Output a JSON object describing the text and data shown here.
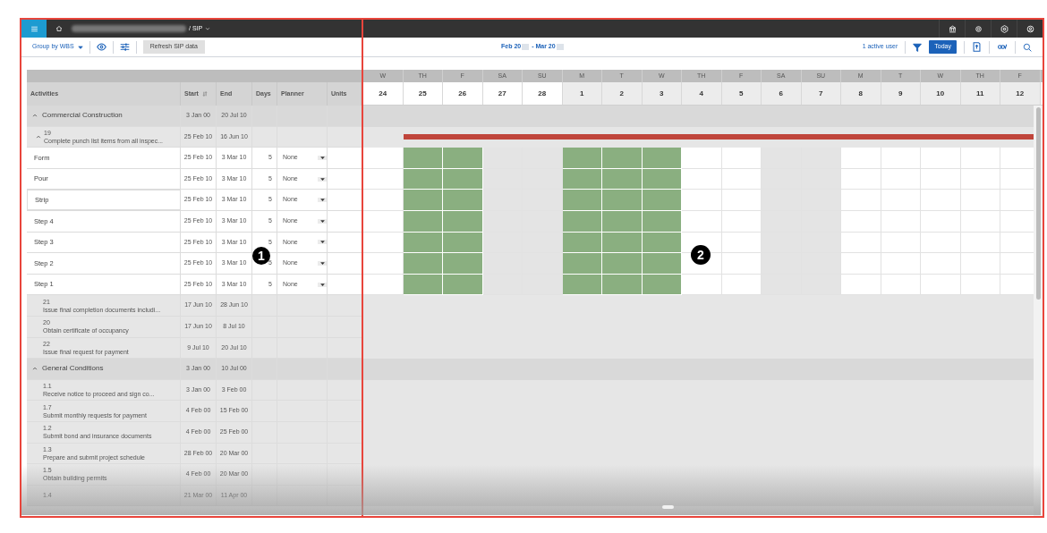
{
  "breadcrumb": {
    "title": "/ SIP"
  },
  "toolbar": {
    "group_by": "Group by WBS",
    "refresh": "Refresh SIP data"
  },
  "schedule_toolbar": {
    "date_from": "Feb 20",
    "date_to": "- Mar 20",
    "active_users": "1 active user",
    "today": "Today"
  },
  "columns": [
    "Activities",
    "Start",
    "End",
    "Days",
    "Planner",
    "Units"
  ],
  "days": [
    {
      "dow": "W",
      "day": "24",
      "current_month": false,
      "weekend": false,
      "scheduled": false
    },
    {
      "dow": "TH",
      "day": "25",
      "current_month": false,
      "weekend": false,
      "scheduled": true
    },
    {
      "dow": "F",
      "day": "26",
      "current_month": false,
      "weekend": false,
      "scheduled": true
    },
    {
      "dow": "SA",
      "day": "27",
      "current_month": false,
      "weekend": true,
      "scheduled": false
    },
    {
      "dow": "SU",
      "day": "28",
      "current_month": false,
      "weekend": true,
      "scheduled": false
    },
    {
      "dow": "M",
      "day": "1",
      "current_month": true,
      "weekend": false,
      "scheduled": true
    },
    {
      "dow": "T",
      "day": "2",
      "current_month": true,
      "weekend": false,
      "scheduled": true
    },
    {
      "dow": "W",
      "day": "3",
      "current_month": true,
      "weekend": false,
      "scheduled": true
    },
    {
      "dow": "TH",
      "day": "4",
      "current_month": true,
      "weekend": false,
      "scheduled": false
    },
    {
      "dow": "F",
      "day": "5",
      "current_month": true,
      "weekend": false,
      "scheduled": false
    },
    {
      "dow": "SA",
      "day": "6",
      "current_month": true,
      "weekend": true,
      "scheduled": false
    },
    {
      "dow": "SU",
      "day": "7",
      "current_month": true,
      "weekend": true,
      "scheduled": false
    },
    {
      "dow": "M",
      "day": "8",
      "current_month": true,
      "weekend": false,
      "scheduled": false
    },
    {
      "dow": "T",
      "day": "9",
      "current_month": true,
      "weekend": false,
      "scheduled": false
    },
    {
      "dow": "W",
      "day": "10",
      "current_month": true,
      "weekend": false,
      "scheduled": false
    },
    {
      "dow": "TH",
      "day": "11",
      "current_month": true,
      "weekend": false,
      "scheduled": false
    },
    {
      "dow": "F",
      "day": "12",
      "current_month": true,
      "weekend": false,
      "scheduled": false
    }
  ],
  "rows": [
    {
      "kind": "group",
      "name": "Commercial Construction",
      "start": "3 Jan 00",
      "end": "20 Jul 10"
    },
    {
      "kind": "summary",
      "number": "19",
      "name": "Complete punch list items from all inspec...",
      "start": "25 Feb 10",
      "end": "16 Jun 10"
    },
    {
      "kind": "task",
      "name": "Form",
      "start": "25 Feb 10",
      "end": "3 Mar 10",
      "days": "5",
      "planner": "None",
      "selected": false
    },
    {
      "kind": "task",
      "name": "Pour",
      "start": "25 Feb 10",
      "end": "3 Mar 10",
      "days": "5",
      "planner": "None",
      "selected": false
    },
    {
      "kind": "task",
      "name": "Strip",
      "start": "25 Feb 10",
      "end": "3 Mar 10",
      "days": "5",
      "planner": "None",
      "selected": true
    },
    {
      "kind": "task",
      "name": "Step 4",
      "start": "25 Feb 10",
      "end": "3 Mar 10",
      "days": "5",
      "planner": "None",
      "selected": false
    },
    {
      "kind": "task",
      "name": "Step 3",
      "start": "25 Feb 10",
      "end": "3 Mar 10",
      "days": "5",
      "planner": "None",
      "selected": false
    },
    {
      "kind": "task",
      "name": "Step 2",
      "start": "25 Feb 10",
      "end": "3 Mar 10",
      "days": "5",
      "planner": "None",
      "selected": false
    },
    {
      "kind": "task",
      "name": "Step 1",
      "start": "25 Feb 10",
      "end": "3 Mar 10",
      "days": "5",
      "planner": "None",
      "selected": false
    },
    {
      "kind": "activity",
      "number": "21",
      "name": "Issue final completion documents includi...",
      "start": "17 Jun 10",
      "end": "28 Jun 10"
    },
    {
      "kind": "activity",
      "number": "20",
      "name": "Obtain certificate of occupancy",
      "start": "17 Jun 10",
      "end": "8 Jul 10"
    },
    {
      "kind": "activity",
      "number": "22",
      "name": "Issue final request for payment",
      "start": "9 Jul 10",
      "end": "20 Jul 10"
    },
    {
      "kind": "group",
      "name": "General Conditions",
      "start": "3 Jan 00",
      "end": "10 Jul 00"
    },
    {
      "kind": "activity",
      "number": "1.1",
      "name": "Receive notice to proceed and sign co...",
      "start": "3 Jan 00",
      "end": "3 Feb 00"
    },
    {
      "kind": "activity",
      "number": "1.7",
      "name": "Submit monthly requests for payment",
      "start": "4 Feb 00",
      "end": "15 Feb 00"
    },
    {
      "kind": "activity",
      "number": "1.2",
      "name": "Submit bond and insurance documents",
      "start": "4 Feb 00",
      "end": "25 Feb 00"
    },
    {
      "kind": "activity",
      "number": "1.3",
      "name": "Prepare and submit project schedule",
      "start": "28 Feb 00",
      "end": "20 Mar 00"
    },
    {
      "kind": "activity",
      "number": "1.5",
      "name": "Obtain building permits",
      "start": "4 Feb 00",
      "end": "20 Mar 00"
    },
    {
      "kind": "activity",
      "number": "1.4",
      "start": "21 Mar 00",
      "end": "11 Apr 00"
    }
  ],
  "callouts": [
    {
      "label": "1"
    },
    {
      "label": "2"
    }
  ]
}
